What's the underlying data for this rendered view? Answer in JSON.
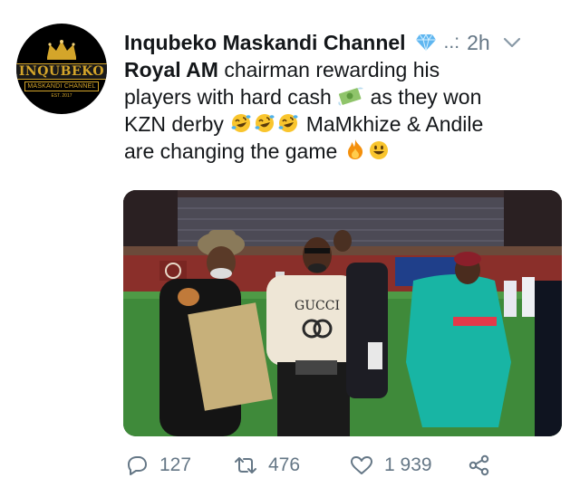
{
  "tweet": {
    "display_name": "Inqubeko Maskandi Channel",
    "handle": "..:",
    "separator": "",
    "time": "2h",
    "avatar": {
      "brand": "INQUBEKO",
      "sub": "MASKANDI CHANNEL",
      "est": "EST. 2017"
    },
    "text": {
      "mention": "Royal AM",
      "line1_rest": " chairman rewarding his",
      "line2": "players with hard cash ",
      "line2_after": " as they won",
      "line3": "KZN derby ",
      "line3_after": " MaMkhize & Andile",
      "line4": "are changing the game "
    },
    "icons": {
      "verified": "diamond-icon",
      "cash": "money-with-wings-icon",
      "laugh": "rolling-on-floor-laughing-icon",
      "fire": "fire-icon",
      "smile": "grinning-face-icon"
    },
    "media": {
      "jersey_text": "GUCCI"
    },
    "actions": {
      "reply_count": "127",
      "retweet_count": "476",
      "like_count": "1 939"
    }
  }
}
